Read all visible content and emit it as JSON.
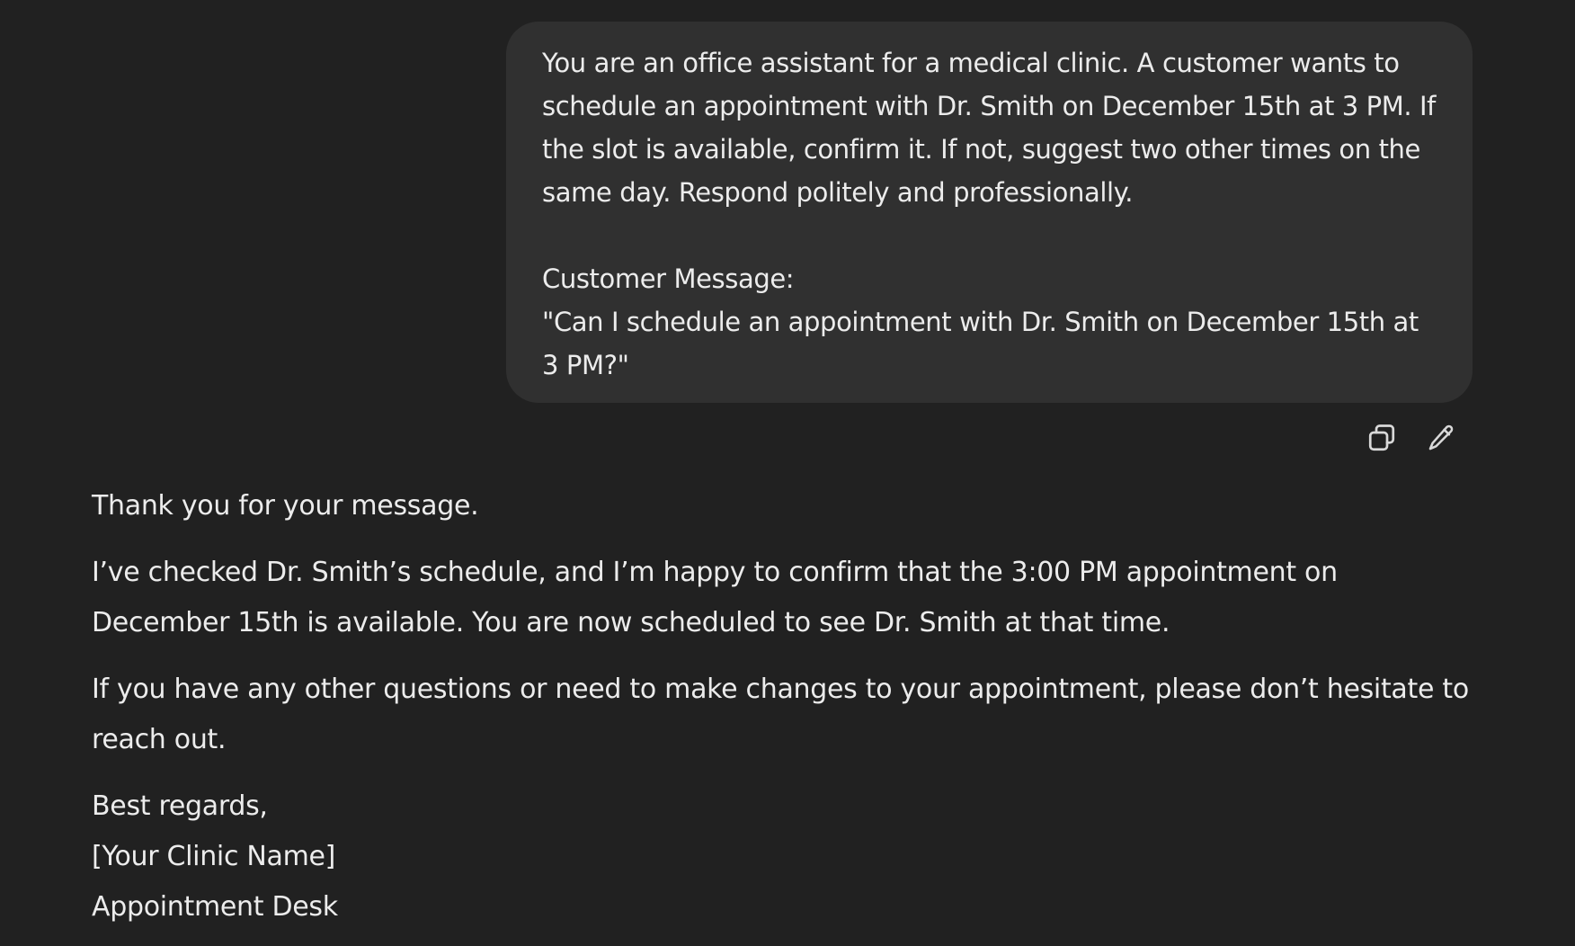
{
  "user_message": {
    "text": "You are an office assistant for a medical clinic. A customer wants to schedule an appointment with Dr. Smith on December 15th at 3 PM. If the slot is available, confirm it. If not, suggest two other times on the same day. Respond politely and professionally.\n\nCustomer Message:\n\"Can I schedule an appointment with Dr. Smith on December 15th at 3 PM?\""
  },
  "message_actions": {
    "copy_icon": "copy-icon",
    "edit_icon": "pencil-icon"
  },
  "assistant_message": {
    "greeting": "Thank you for your message.",
    "paragraph_1": "I’ve checked Dr. Smith’s schedule, and I’m happy to confirm that the 3:00 PM appointment on December 15th is available. You are now scheduled to see Dr. Smith at that time.",
    "paragraph_2": "If you have any other questions or need to make changes to your appointment, please don’t hesitate to reach out.",
    "signoff": "Best regards,",
    "clinic_name": "[Your Clinic Name]",
    "desk": "Appointment Desk"
  },
  "colors": {
    "background": "#212121",
    "bubble": "#303030",
    "text": "#ececec"
  }
}
